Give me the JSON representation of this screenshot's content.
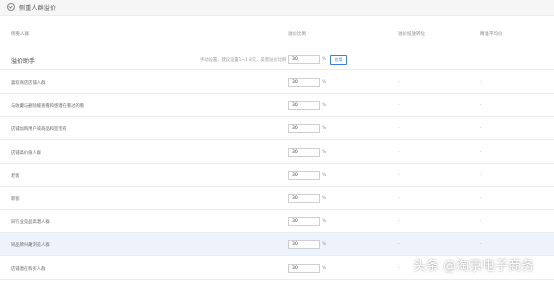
{
  "section": {
    "title": "侧重人群溢价"
  },
  "table_headers": [
    "侧重人群",
    "溢价比例",
    "溢价投放转化",
    "精准平均价"
  ],
  "assistant": {
    "title": "溢价助手",
    "hint": "手动设置，建议设置1~1.8元，美景溢价比例",
    "value": "30",
    "unit": "%",
    "apply_label": "应用"
  },
  "rows": [
    {
      "label": "喜欢商店店铺人群",
      "value": "30",
      "unit": "%",
      "col3": "-",
      "col4": "-"
    },
    {
      "label": "与收藏与删除缓查看和感潜在看过的看",
      "value": "30",
      "unit": "%",
      "col3": "-",
      "col4": "-"
    },
    {
      "label": "店铺加购用户或商品和签宝有",
      "value": "30",
      "unit": "%",
      "col3": "-",
      "col4": "-"
    },
    {
      "label": "店铺高价值人群",
      "value": "30",
      "unit": "%",
      "col3": "-",
      "col4": "-"
    },
    {
      "label": "老客",
      "value": "30",
      "unit": "%",
      "col3": "-",
      "col4": "-"
    },
    {
      "label": "新客",
      "value": "30",
      "unit": "%",
      "col3": "-",
      "col4": "-"
    },
    {
      "label": "同行业竞品高潜人群",
      "value": "30",
      "unit": "%",
      "col3": "-",
      "col4": "-"
    },
    {
      "label": "同品牌兴趣浏览人群",
      "value": "30",
      "unit": "%",
      "col3": "-",
      "col4": "-"
    },
    {
      "label": "店铺潜在购买人群",
      "value": "30",
      "unit": "%",
      "col3": "-",
      "col4": "-"
    }
  ],
  "watermark": "头条 @淘京电子商务"
}
